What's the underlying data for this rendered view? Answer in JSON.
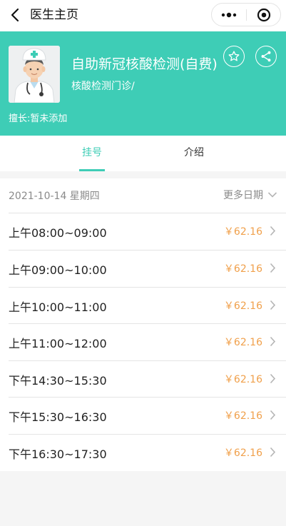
{
  "nav": {
    "title": "医生主页"
  },
  "doctor": {
    "name": "自助新冠核酸检测(自费)",
    "department": "核酸检测门诊/",
    "specialty": "擅长:暂未添加"
  },
  "tabs": [
    {
      "label": "挂号",
      "active": true
    },
    {
      "label": "介绍",
      "active": false
    }
  ],
  "schedule": {
    "date": "2021-10-14 星期四",
    "more_dates_label": "更多日期",
    "slots": [
      {
        "time": "上午08:00~09:00",
        "price": "￥62.16"
      },
      {
        "time": "上午09:00~10:00",
        "price": "￥62.16"
      },
      {
        "time": "上午10:00~11:00",
        "price": "￥62.16"
      },
      {
        "time": "上午11:00~12:00",
        "price": "￥62.16"
      },
      {
        "time": "下午14:30~15:30",
        "price": "￥62.16"
      },
      {
        "time": "下午15:30~16:30",
        "price": "￥62.16"
      },
      {
        "time": "下午16:30~17:30",
        "price": "￥62.16"
      }
    ]
  },
  "colors": {
    "accent": "#3ecdb6",
    "price": "#f0a04b",
    "muted": "#8a8a8a"
  }
}
